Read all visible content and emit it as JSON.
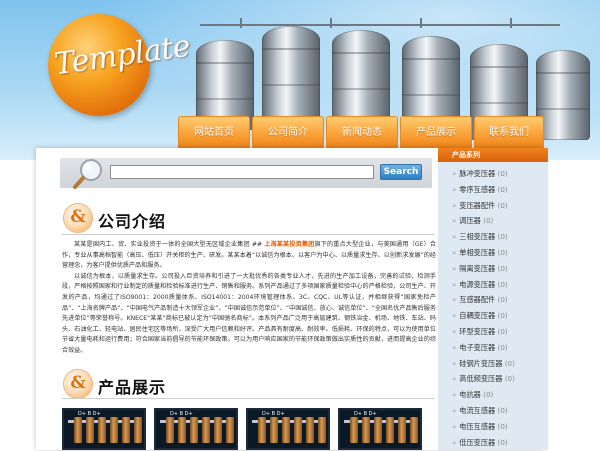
{
  "banner": {
    "logo_text": "Template"
  },
  "nav": {
    "items": [
      "网站首页",
      "公司简介",
      "新闻动态",
      "产品展示",
      "联系我们"
    ]
  },
  "search": {
    "button_label": "Search",
    "value": ""
  },
  "about": {
    "title": "公司介绍",
    "para1_a": "某某是国内工、贸、实业投资于一体的全国大型无区域企业集团 ## ",
    "para1_highlight": "上海某某投资集团",
    "para1_b": "旗下的重点大型企业，与美国通用（GE）合作，专业从事高档智能（高压、低压）开关柜的生产、研发。某某本着“以诚信为根本、以客户为中心、以质量求生存、以创新求发展”的经营理念，为客户提供优质产品和服务。",
    "para2": "以诚信为根本，以质量求生存。公司投入巨资培养和引进了一大批优秀的各类专业人才，先进的生产加工设备，完善的试验、检测手段，严格按照国家和行业制定的质量和检验标准进行生产、销售和服务。系列产品通过了多项国家质量检验中心的严格检验，公司生产、开发的产品，均通过了ISO9001：2000质量体系、ISO14001：2004环境管理体系、3C、CQC、UL等认证，并相继获得“国家免检产品”、“上海名牌产品”、“中国电气产品制造十大领军企业”、“中国诚信示范单位”、“中国诚信、放心、诚信单位”、“全国名优产品售后服务先进单位”等荣誉称号。KNECE“某某”商标已被认定为“中国驰名商标”。本系列产品广泛用于高层建筑、钢铁冶金、机场、地铁、车站、码头、石油化工、轻电站、居民住宅区等场所，深受广大用户信赖和好评。产品具有耐度高、耐效率、低损耗、环保的特点，可以为使用单位节省大量电耗和运行费用；符合国家当前倡导的节能环保政策。可以为用户响应国家的节能环保政策做出实质性的贡献，进而提高企业的综合效益。"
  },
  "products": {
    "title": "产品展示",
    "items": [
      {
        "label": "D+ B D+"
      },
      {
        "label": "D+ B D+"
      },
      {
        "label": "D+ B D+"
      },
      {
        "label": "D+ B D+"
      }
    ]
  },
  "sidebar": {
    "title": "产品系列",
    "items": [
      {
        "name": "脉冲变压器",
        "count": "(0)"
      },
      {
        "name": "零序互感器",
        "count": "(0)"
      },
      {
        "name": "变压器配件",
        "count": "(0)"
      },
      {
        "name": "调压器",
        "count": "(0)"
      },
      {
        "name": "三相变压器",
        "count": "(0)"
      },
      {
        "name": "单相变压器",
        "count": "(0)"
      },
      {
        "name": "隔离变压器",
        "count": "(0)"
      },
      {
        "name": "电源变压器",
        "count": "(0)"
      },
      {
        "name": "互感器配件",
        "count": "(0)"
      },
      {
        "name": "自耦变压器",
        "count": "(0)"
      },
      {
        "name": "环型变压器",
        "count": "(0)"
      },
      {
        "name": "电子变压器",
        "count": "(0)"
      },
      {
        "name": "硅钢片变压器",
        "count": "(0)"
      },
      {
        "name": "高低频变压器",
        "count": "(0)"
      },
      {
        "name": "电抗器",
        "count": "(0)"
      },
      {
        "name": "电流互感器",
        "count": "(0)"
      },
      {
        "name": "电压互感器",
        "count": "(0)"
      },
      {
        "name": "低压变压器",
        "count": "(0)"
      }
    ]
  },
  "colors": {
    "accent_orange": "#f39a2f",
    "sidebar_bg": "#dfe9f4",
    "search_button": "#2e7fc2",
    "highlight": "#e05a00"
  }
}
